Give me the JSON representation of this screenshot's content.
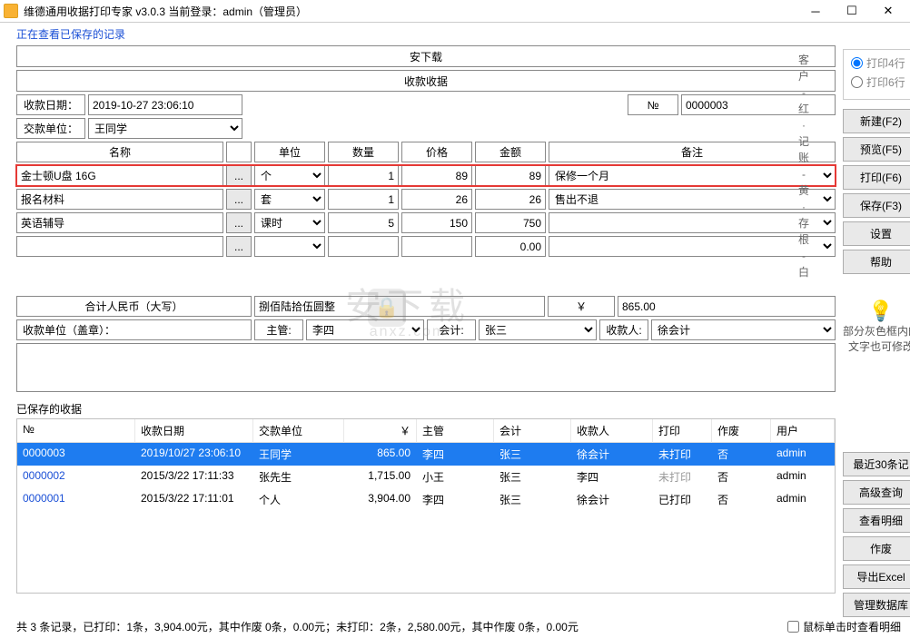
{
  "window": {
    "title": "维德通用收据打印专家 v3.0.3     当前登录：admin（管理员）"
  },
  "status_msg": "正在查看已保存的记录",
  "receipt": {
    "top_title": "安下载",
    "sub_title": "收款收据",
    "date_label": "收款日期：",
    "date_value": "2019-10-27 23:06:10",
    "payer_label": "交款单位：",
    "payer_value": "王同学",
    "no_symbol": "№",
    "no_value": "0000003",
    "cols": {
      "name": "名称",
      "unit": "单位",
      "qty": "数量",
      "price": "价格",
      "amount": "金额",
      "note": "备注"
    },
    "items": [
      {
        "name": "金士顿U盘 16G",
        "unit": "个",
        "qty": "1",
        "price": "89",
        "amount": "89",
        "note": "保修一个月"
      },
      {
        "name": "报名材料",
        "unit": "套",
        "qty": "1",
        "price": "26",
        "amount": "26",
        "note": "售出不退"
      },
      {
        "name": "英语辅导",
        "unit": "课时",
        "qty": "5",
        "price": "150",
        "amount": "750",
        "note": ""
      },
      {
        "name": "",
        "unit": "",
        "qty": "",
        "price": "",
        "amount": "0.00",
        "note": ""
      }
    ],
    "total_label": "合计人民币（大写）",
    "total_cn": "捌佰陆拾伍圆整",
    "currency": "￥",
    "total_num": "865.00",
    "stamp_label": "收款单位（盖章）：",
    "supervisor_label": "主管:",
    "supervisor_value": "李四",
    "accountant_label": "会计:",
    "accountant_value": "张三",
    "cashier_label": "收款人:",
    "cashier_value": "徐会计"
  },
  "side_strip": [
    "客",
    "户",
    "-",
    "红",
    "·",
    "记",
    "账",
    "-",
    "黄",
    "·",
    "存",
    "根",
    "-",
    "白"
  ],
  "right": {
    "radio1": "打印4行",
    "radio2": "打印6行",
    "buttons1": [
      "新建(F2)",
      "预览(F5)",
      "打印(F6)",
      "保存(F3)",
      "设置",
      "帮助"
    ],
    "hint": "部分灰色框内的文字也可修改",
    "buttons2": [
      "最近30条记",
      "高级查询",
      "查看明细",
      "作废",
      "导出Excel",
      "管理数据库"
    ]
  },
  "saved": {
    "title": "已保存的收据",
    "cols": {
      "no": "№",
      "date": "收款日期",
      "payer": "交款单位",
      "amt": "￥",
      "sup": "主管",
      "acc": "会计",
      "cash": "收款人",
      "prn": "打印",
      "voided": "作废",
      "user": "用户"
    },
    "rows": [
      {
        "no": "0000003",
        "date": "2019/10/27 23:06:10",
        "payer": "王同学",
        "amt": "865.00",
        "sup": "李四",
        "acc": "张三",
        "cash": "徐会计",
        "prn": "未打印",
        "voided": "否",
        "user": "admin",
        "sel": true
      },
      {
        "no": "0000002",
        "date": "2015/3/22 17:11:33",
        "payer": "张先生",
        "amt": "1,715.00",
        "sup": "小王",
        "acc": "张三",
        "cash": "李四",
        "prn": "未打印",
        "voided": "否",
        "user": "admin",
        "prn_muted": true
      },
      {
        "no": "0000001",
        "date": "2015/3/22 17:11:01",
        "payer": "个人",
        "amt": "3,904.00",
        "sup": "李四",
        "acc": "张三",
        "cash": "徐会计",
        "prn": "已打印",
        "voided": "否",
        "user": "admin"
      }
    ]
  },
  "footer": {
    "summary": "共 3 条记录，已打印：1条，3,904.00元，其中作废 0条，0.00元；未打印：2条，2,580.00元，其中作废 0条，0.00元",
    "chk_label": "鼠标单击时查看明细"
  }
}
